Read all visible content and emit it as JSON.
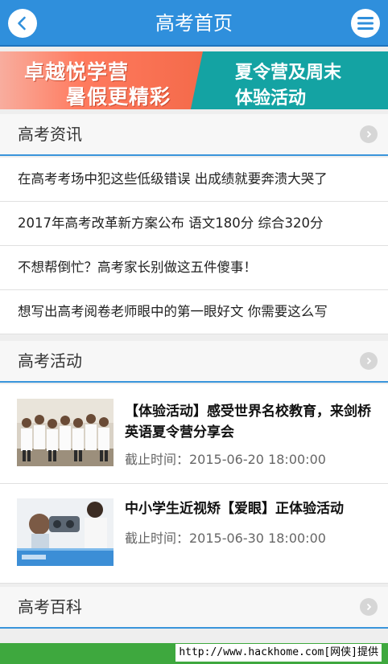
{
  "header": {
    "title": "高考首页",
    "back_icon": "chevron-left-icon",
    "menu_icon": "hamburger-menu-icon"
  },
  "banner": {
    "left_line1": "卓越悦学营",
    "left_line2": "暑假更精彩",
    "right_line1": "夏令营及周末",
    "right_line2": "体验活动"
  },
  "news": {
    "title": "高考资讯",
    "items": [
      "在高考考场中犯这些低级错误 出成绩就要奔溃大哭了",
      "2017年高考改革新方案公布 语文180分 综合320分",
      "不想帮倒忙？高考家长别做这五件傻事！",
      "想写出高考阅卷老师眼中的第一眼好文 你需要这么写"
    ]
  },
  "activities": {
    "title": "高考活动",
    "items": [
      {
        "title": "【体验活动】感受世界名校教育，来剑桥英语夏令营分享会",
        "deadline": "截止时间：2015-06-20 18:00:00"
      },
      {
        "title": "中小学生近视矫【爱眼】正体验活动",
        "deadline": "截止时间：2015-06-30 18:00:00"
      }
    ]
  },
  "encyclopedia": {
    "title": "高考百科"
  },
  "watermark": "http://www.hackhome.com[网侠]提供",
  "colors": {
    "header": "#2f8fdc",
    "accent_line": "#3a95db",
    "footer": "#3ea83e"
  }
}
